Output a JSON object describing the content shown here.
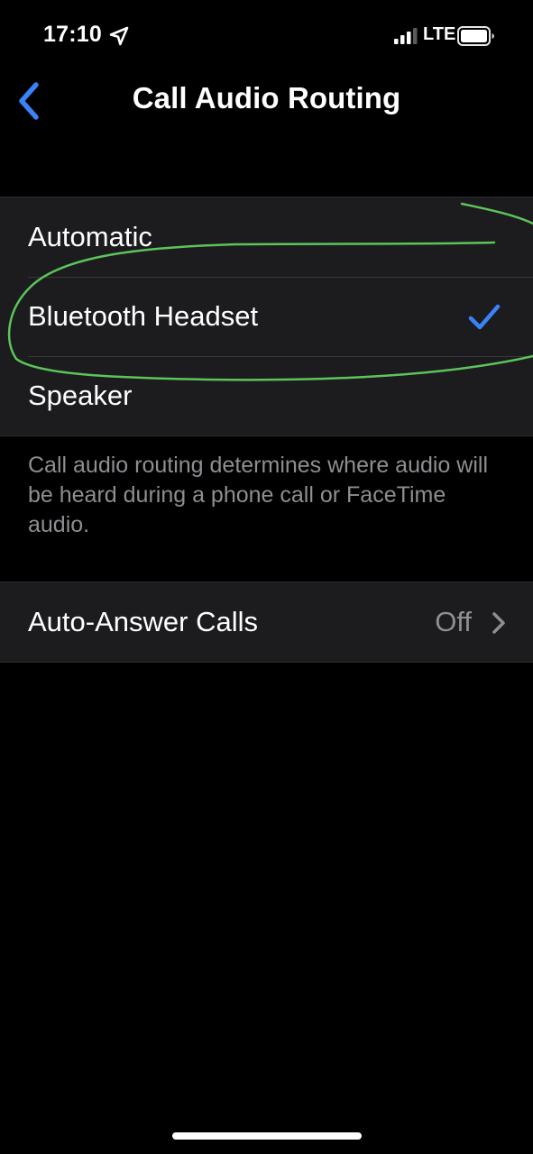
{
  "status_bar": {
    "time": "17:10",
    "network": "LTE",
    "icons": [
      "location-arrow-icon",
      "cellular-signal-icon",
      "battery-icon"
    ]
  },
  "nav": {
    "title": "Call Audio Routing",
    "back_icon": "chevron-left-icon"
  },
  "routing_options": {
    "items": [
      {
        "label": "Automatic",
        "selected": false
      },
      {
        "label": "Bluetooth Headset",
        "selected": true
      },
      {
        "label": "Speaker",
        "selected": false
      }
    ]
  },
  "footer": {
    "text": "Call audio routing determines where audio will be heard during a phone call or FaceTime audio."
  },
  "auto_answer": {
    "label": "Auto-Answer Calls",
    "value": "Off"
  },
  "colors": {
    "accent": "#3a82f7",
    "annotation": "#5cc45a",
    "background": "#000000",
    "cell": "#1c1c1e",
    "secondary_text": "#8e8e93"
  }
}
